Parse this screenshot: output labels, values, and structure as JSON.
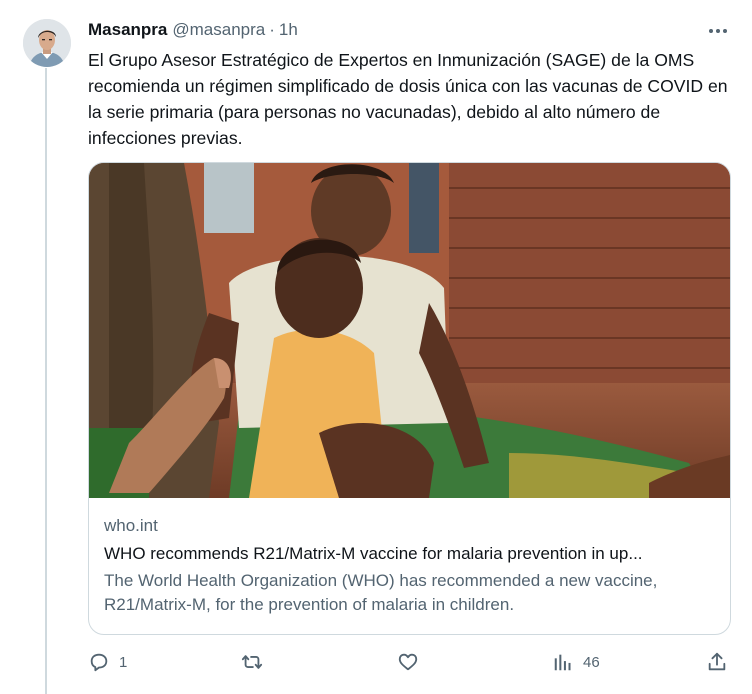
{
  "tweet": {
    "author_name": "Masanpra",
    "author_handle": "@masanpra",
    "separator": "·",
    "timestamp": "1h",
    "text": "El Grupo Asesor Estratégico de Expertos en Inmunización (SAGE) de la OMS recomienda un régimen simplificado de dosis única con las vacunas de COVID en la serie primaria (para personas no vacunadas), debido al alto número de infecciones previas."
  },
  "card": {
    "domain": "who.int",
    "title": "WHO recommends R21/Matrix-M vaccine for malaria prevention in up...",
    "description": "The World Health Organization (WHO) has recommended a new vaccine, R21/Matrix-M, for the prevention of malaria in children."
  },
  "actions": {
    "reply_count": "1",
    "retweet_count": "",
    "like_count": "",
    "views_count": "46"
  },
  "icons": {
    "more": "more-icon",
    "reply": "reply-icon",
    "retweet": "retweet-icon",
    "like": "heart-icon",
    "views": "views-icon",
    "share": "share-icon"
  },
  "colors": {
    "text": "#0f1419",
    "secondary": "#536471",
    "border": "#cfd9de"
  }
}
